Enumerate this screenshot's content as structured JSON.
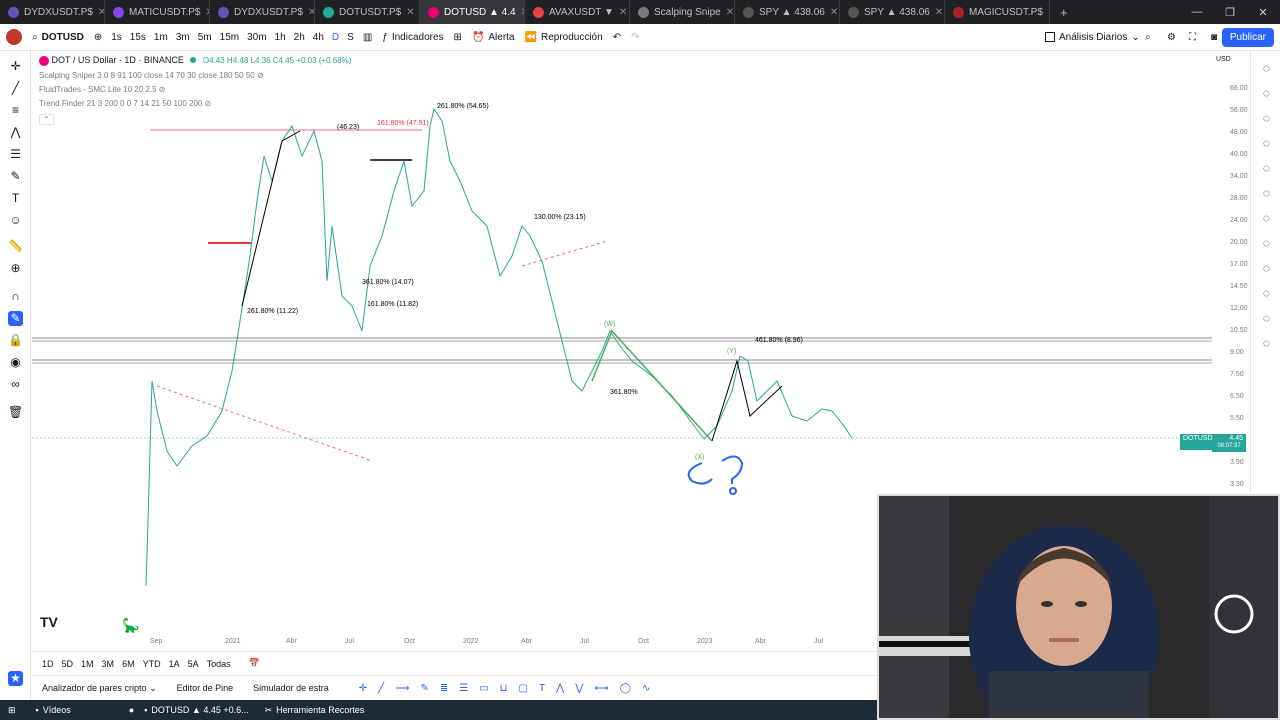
{
  "browser": {
    "tabs": [
      {
        "label": "DYDXUSDT.P$",
        "color": "#6b4fbb"
      },
      {
        "label": "MATICUSDT.P$",
        "color": "#8247e5"
      },
      {
        "label": "DYDXUSDT.P$",
        "color": "#6b4fbb"
      },
      {
        "label": "DOTUSDT.P$",
        "color": "#26a69a"
      },
      {
        "label": "DOTUSD ▲ 4.4",
        "color": "#e6007a",
        "active": true
      },
      {
        "label": "AVAXUSDT ▼",
        "color": "#e84142"
      },
      {
        "label": "Scalping Snipe",
        "color": "#787b86"
      },
      {
        "label": "SPY ▲ 438.06",
        "color": "#555"
      },
      {
        "label": "SPY ▲ 438.06",
        "color": "#555"
      },
      {
        "label": "MAGICUSDT.P$",
        "color": "#aa2222"
      }
    ]
  },
  "toolbar": {
    "symbol": "DOTUSD",
    "intervals": [
      "1s",
      "15s",
      "1m",
      "3m",
      "5m",
      "15m",
      "30m",
      "1h",
      "2h",
      "4h",
      "D",
      "S"
    ],
    "indicators_label": "Indicadores",
    "alert_label": "Alerta",
    "replay_label": "Reproducción",
    "layout_label": "Análisis Diarios",
    "publish_label": "Publicar"
  },
  "chart": {
    "title": "DOT / US Dollar · 1D · BINANCE",
    "ohlc": "O4.43 H4.48 L4.36 C4.45 +0.03 (+0.68%)",
    "indicators": [
      "Scalping Sniper 3.0 8 91 100 close 14 70 30 close 180 50 50",
      "FluidTrades - SMC Lite 10 20 2.5",
      "Trend Finder 21 3 200 0 0 7 14 21 50 100 200"
    ],
    "currency": "USD",
    "price_ticks": [
      "66.00",
      "56.00",
      "48.00",
      "40.00",
      "34.00",
      "28.00",
      "24.00",
      "20.00",
      "17.00",
      "14.50",
      "12.00",
      "10.50",
      "9.00",
      "7.50",
      "6.50",
      "5.50",
      "4.50",
      "3.90",
      "3.30"
    ],
    "time_ticks": [
      "Sep",
      "2021",
      "Abr",
      "Jul",
      "Oct",
      "2022",
      "Abr",
      "Jul",
      "Oct",
      "2023",
      "Abr",
      "Jul"
    ],
    "current_price": "4.45",
    "current_symbol": "DOTUSD",
    "countdown": "08:07:37",
    "annotations": [
      {
        "text": "261.80% (54.65)"
      },
      {
        "text": "161.80% (47.91)"
      },
      {
        "text": "(46.23)"
      },
      {
        "text": "130.00% (23.15)"
      },
      {
        "text": "261.80% (11.22)"
      },
      {
        "text": "361.80% (14.07)"
      },
      {
        "text": "161.80% (11.82)"
      },
      {
        "text": "461.80% (8.96)"
      },
      {
        "text": "361.80%"
      },
      {
        "text": "(W)"
      },
      {
        "text": "(Y)"
      },
      {
        "text": "(X)"
      }
    ]
  },
  "bottom": {
    "ranges": [
      "1D",
      "5D",
      "1M",
      "3M",
      "6M",
      "YTD",
      "1A",
      "5A",
      "Todas"
    ],
    "panels": [
      "Analizador de pares cripto",
      "Editor de Pine",
      "Simulador de estra"
    ]
  },
  "taskbar": {
    "items": [
      "Vídeos",
      "DOTUSD ▲ 4.45 +0.6...",
      "Herramienta Recortes"
    ]
  }
}
